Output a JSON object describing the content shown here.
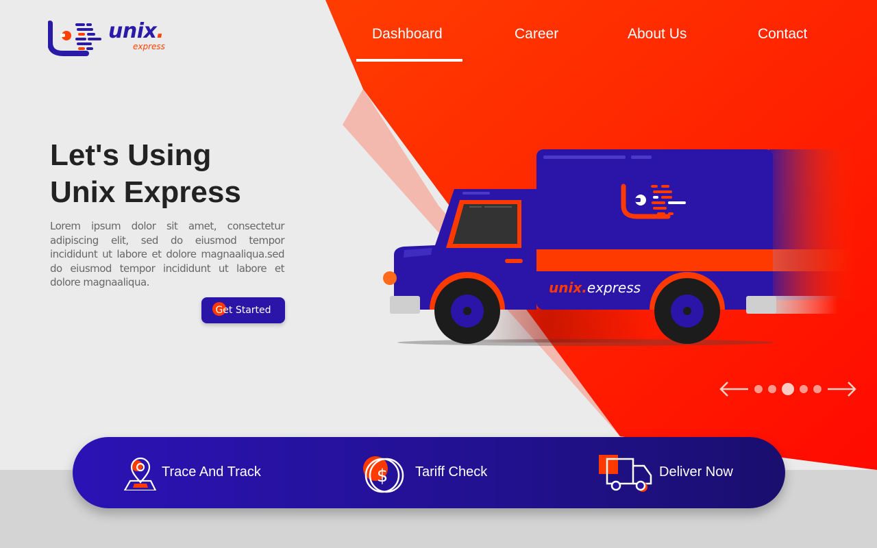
{
  "brand": {
    "name": "unix",
    "dot": ".",
    "tagline": "express",
    "primary_color": "#2b15a8",
    "accent_color": "#ff3a00"
  },
  "nav": {
    "items": [
      {
        "label": "Dashboard",
        "active": true
      },
      {
        "label": "Career",
        "active": false
      },
      {
        "label": "About Us",
        "active": false
      },
      {
        "label": "Contact",
        "active": false
      }
    ]
  },
  "hero": {
    "title_line1": "Let's Using",
    "title_line2": "Unix Express",
    "description": "Lorem ipsum dolor sit amet, consectetur adipiscing elit, sed do eiusmod tempor incididunt ut labore et dolore magnaaliqua.sed do eiusmod tempor incididunt ut labore et dolore magnaaliqua.",
    "cta_label": "Get Started"
  },
  "truck": {
    "brand_text": "unix",
    "brand_dot": ".",
    "brand_sub": "express"
  },
  "slider": {
    "prev_icon": "arrow-left-icon",
    "next_icon": "arrow-right-icon",
    "dot_count": 5,
    "active_index": 2
  },
  "features": {
    "items": [
      {
        "label": "Trace And Track",
        "icon": "map-pin-icon"
      },
      {
        "label": "Tariff Check",
        "icon": "dollar-coin-icon"
      },
      {
        "label": "Deliver Now",
        "icon": "delivery-truck-icon"
      }
    ]
  }
}
